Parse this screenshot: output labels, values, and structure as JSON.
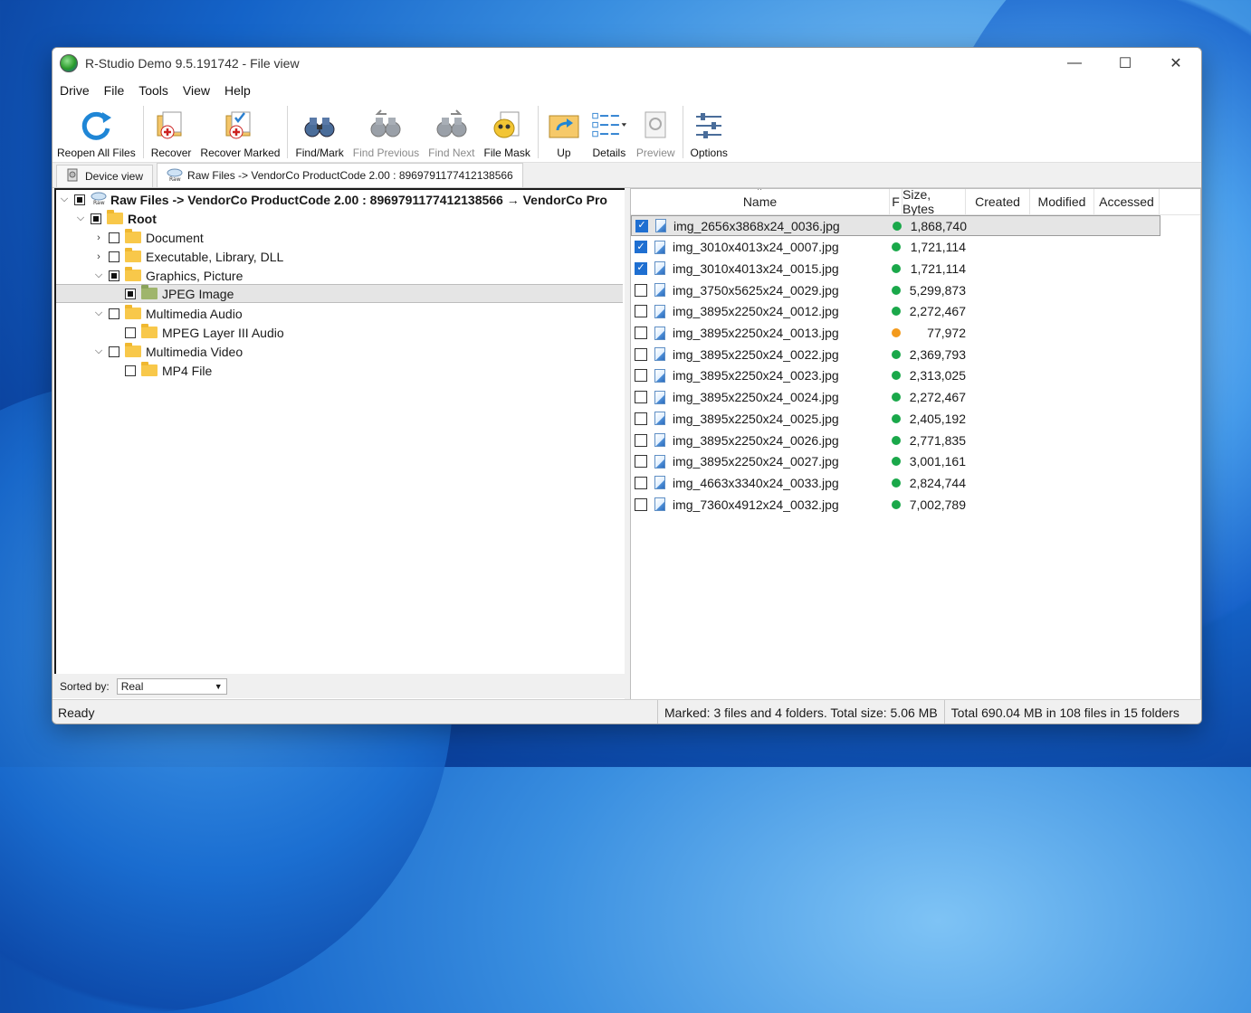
{
  "window": {
    "title": "R-Studio Demo 9.5.191742 - File view",
    "controls": {
      "minimize": "—",
      "maximize": "☐",
      "close": "✕"
    }
  },
  "menu": [
    "Drive",
    "File",
    "Tools",
    "View",
    "Help"
  ],
  "toolbar": {
    "reopen": "Reopen All Files",
    "recover": "Recover",
    "recover_marked": "Recover Marked",
    "find_mark": "Find/Mark",
    "find_previous": "Find Previous",
    "find_next": "Find Next",
    "file_mask": "File Mask",
    "up": "Up",
    "details": "Details",
    "preview": "Preview",
    "options": "Options"
  },
  "tabs": {
    "device_view": "Device view",
    "raw_files": "Raw Files -> VendorCo ProductCode 2.00 : 8969791177412138566"
  },
  "tree": {
    "root_label": "Raw Files -> VendorCo ProductCode 2.00 : 8969791177412138566 → VendorCo Pro",
    "root_folder": "Root",
    "items": [
      "Document",
      "Executable, Library, DLL",
      "Graphics, Picture",
      "JPEG Image",
      "Multimedia Audio",
      "MPEG Layer III Audio",
      "Multimedia Video",
      "MP4 File"
    ]
  },
  "sort": {
    "label": "Sorted by:",
    "value": "Real"
  },
  "columns": {
    "name": "Name",
    "flag": "F",
    "size": "Size, Bytes",
    "created": "Created",
    "modified": "Modified",
    "accessed": "Accessed"
  },
  "files": [
    {
      "name": "img_2656x3868x24_0036.jpg",
      "size": "1,868,740",
      "checked": true,
      "status": "#1aa84a"
    },
    {
      "name": "img_3010x4013x24_0007.jpg",
      "size": "1,721,114",
      "checked": true,
      "status": "#1aa84a"
    },
    {
      "name": "img_3010x4013x24_0015.jpg",
      "size": "1,721,114",
      "checked": true,
      "status": "#1aa84a"
    },
    {
      "name": "img_3750x5625x24_0029.jpg",
      "size": "5,299,873",
      "checked": false,
      "status": "#1aa84a"
    },
    {
      "name": "img_3895x2250x24_0012.jpg",
      "size": "2,272,467",
      "checked": false,
      "status": "#1aa84a"
    },
    {
      "name": "img_3895x2250x24_0013.jpg",
      "size": "77,972",
      "checked": false,
      "status": "#f39a1c"
    },
    {
      "name": "img_3895x2250x24_0022.jpg",
      "size": "2,369,793",
      "checked": false,
      "status": "#1aa84a"
    },
    {
      "name": "img_3895x2250x24_0023.jpg",
      "size": "2,313,025",
      "checked": false,
      "status": "#1aa84a"
    },
    {
      "name": "img_3895x2250x24_0024.jpg",
      "size": "2,272,467",
      "checked": false,
      "status": "#1aa84a"
    },
    {
      "name": "img_3895x2250x24_0025.jpg",
      "size": "2,405,192",
      "checked": false,
      "status": "#1aa84a"
    },
    {
      "name": "img_3895x2250x24_0026.jpg",
      "size": "2,771,835",
      "checked": false,
      "status": "#1aa84a"
    },
    {
      "name": "img_3895x2250x24_0027.jpg",
      "size": "3,001,161",
      "checked": false,
      "status": "#1aa84a"
    },
    {
      "name": "img_4663x3340x24_0033.jpg",
      "size": "2,824,744",
      "checked": false,
      "status": "#1aa84a"
    },
    {
      "name": "img_7360x4912x24_0032.jpg",
      "size": "7,002,789",
      "checked": false,
      "status": "#1aa84a"
    }
  ],
  "status": {
    "ready": "Ready",
    "marked": "Marked: 3 files and 4 folders. Total size: 5.06 MB",
    "total": "Total 690.04 MB in 108 files in 15 folders"
  }
}
